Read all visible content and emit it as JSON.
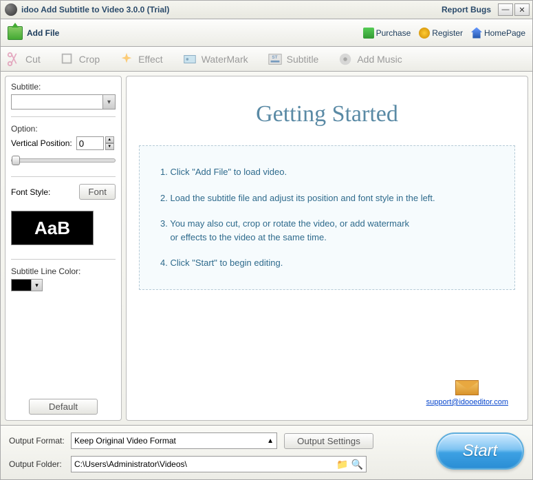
{
  "titlebar": {
    "title": "idoo Add Subtitle to Video 3.0.0 (Trial)",
    "report": "Report Bugs"
  },
  "toolbar": {
    "addfile": "Add File",
    "purchase": "Purchase",
    "register": "Register",
    "homepage": "HomePage"
  },
  "tabs": {
    "cut": "Cut",
    "crop": "Crop",
    "effect": "Effect",
    "watermark": "WaterMark",
    "subtitle": "Subtitle",
    "addmusic": "Add Music"
  },
  "left": {
    "subtitle_label": "Subtitle:",
    "option_label": "Option:",
    "vpos_label": "Vertical Position:",
    "vpos_value": "0",
    "fontstyle_label": "Font Style:",
    "font_btn": "Font",
    "font_preview": "AaB",
    "linecolor_label": "Subtitle Line Color:",
    "default_btn": "Default"
  },
  "right": {
    "title": "Getting Started",
    "step1": "1. Click \"Add File\" to load video.",
    "step2": "2. Load the subtitle file and adjust its position and font style in the left.",
    "step3a": "3. You may also cut, crop or rotate the video, or add watermark",
    "step3b": "or effects to the video at the same time.",
    "step4": "4. Click \"Start\" to begin editing.",
    "support": "support@idooeditor.com"
  },
  "bottom": {
    "outfmt_label": "Output Format:",
    "outfmt_value": "Keep Original Video Format",
    "outsettings": "Output Settings",
    "outfolder_label": "Output Folder:",
    "outfolder_value": "C:\\Users\\Administrator\\Videos\\",
    "start": "Start"
  }
}
